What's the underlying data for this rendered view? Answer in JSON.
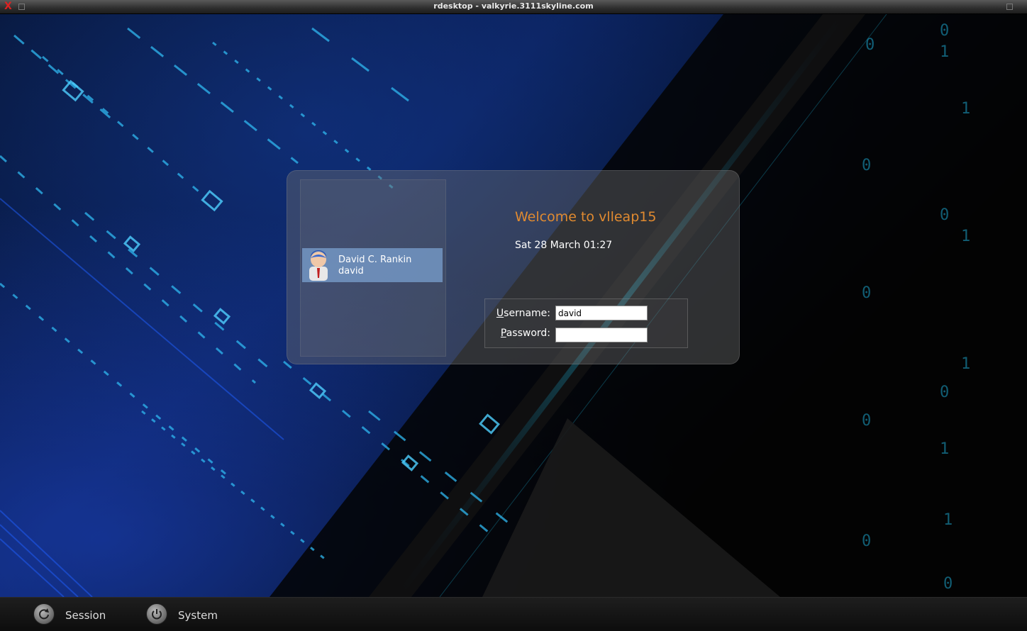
{
  "window": {
    "title": "rdesktop - valkyrie.3111skyline.com",
    "close_glyph": "X"
  },
  "login": {
    "welcome": "Welcome to vlleap15",
    "datetime": "Sat 28 March 01:27",
    "users": [
      {
        "full_name": "David C. Rankin",
        "login": "david",
        "icon": "user-avatar-icon"
      }
    ],
    "username_label_first": "U",
    "username_label_rest": "sername:",
    "username_value": "david",
    "password_label_first": "P",
    "password_label_rest": "assword:",
    "password_value": ""
  },
  "bottom_bar": {
    "session_label": "Session",
    "session_icon": "refresh-icon",
    "system_label": "System",
    "system_icon": "power-icon"
  },
  "colors": {
    "welcome": "#e08a30",
    "selected_user": "#7396c3"
  }
}
